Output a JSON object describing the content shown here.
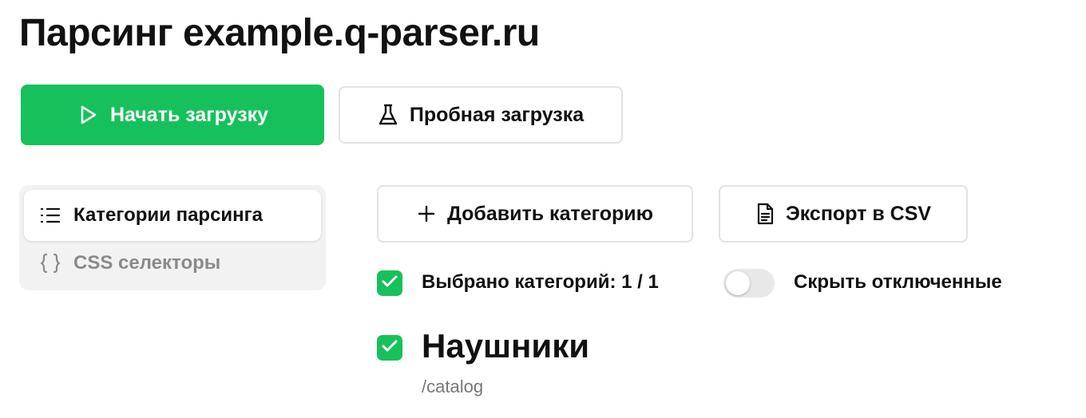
{
  "page": {
    "title": "Парсинг example.q-parser.ru"
  },
  "actions": {
    "start_label": "Начать загрузку",
    "trial_label": "Пробная загрузка",
    "add_category_label": "Добавить категорию",
    "export_label": "Экспорт в CSV"
  },
  "tabs": [
    {
      "label": "Категории парсинга",
      "icon": "list-icon",
      "active": true
    },
    {
      "label": "CSS селекторы",
      "icon": "braces-icon",
      "active": false
    }
  ],
  "selection": {
    "label": "Выбрано категорий: 1 / 1",
    "checked": true
  },
  "filters": {
    "hide_disabled_label": "Скрыть отключенные",
    "hide_disabled": false
  },
  "categories": [
    {
      "name": "Наушники",
      "path": "/catalog",
      "checked": true
    }
  ],
  "colors": {
    "accent": "#16c15b",
    "muted_text": "#8a8a8a",
    "border": "#e3e3e3"
  }
}
